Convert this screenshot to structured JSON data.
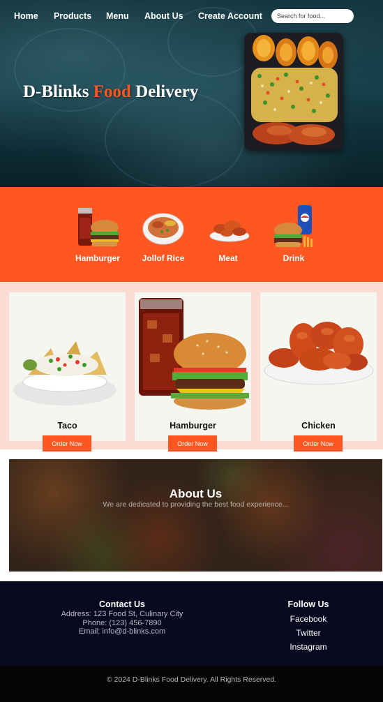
{
  "nav": {
    "items": [
      "Home",
      "Products",
      "Menu",
      "About Us",
      "Create Account"
    ],
    "search_placeholder": "Search for food..."
  },
  "hero": {
    "title_part1": "D-Blinks ",
    "title_accent": "Food",
    "title_part2": " Delivery"
  },
  "categories": [
    {
      "label": "Hamburger",
      "icon": "burger-soda-icon"
    },
    {
      "label": "Jollof Rice",
      "icon": "jollof-rice-icon"
    },
    {
      "label": "Meat",
      "icon": "meat-icon"
    },
    {
      "label": "Drink",
      "icon": "drink-icon"
    }
  ],
  "products": [
    {
      "title": "Taco",
      "button": "Order Now"
    },
    {
      "title": "Hamburger",
      "button": "Order Now"
    },
    {
      "title": "Chicken",
      "button": "Order Now"
    }
  ],
  "about": {
    "title": "About Us",
    "text": "We are dedicated to providing the best food experience..."
  },
  "footer": {
    "contact_title": "Contact Us",
    "address": "Address: 123 Food St, Culinary City",
    "phone": "Phone: (123) 456-7890",
    "email": "Email: info@d-blinks.com",
    "follow_title": "Follow Us",
    "social": [
      "Facebook",
      "Twitter",
      "Instagram"
    ],
    "copyright": "© 2024 D-Blinks Food Delivery. All Rights Reserved."
  },
  "colors": {
    "accent": "#ff5722",
    "products_bg": "#fbdcd3",
    "footer_bg": "#070a1f"
  }
}
